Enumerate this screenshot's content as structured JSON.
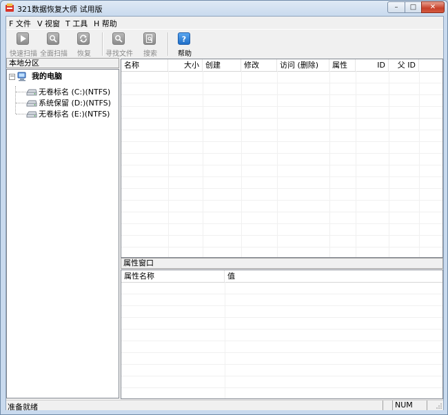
{
  "window": {
    "title": "321数据恢复大师 试用版",
    "controls": {
      "minimize": "–",
      "maximize": "□",
      "close": "✕"
    }
  },
  "menu": [
    {
      "label": "F 文件"
    },
    {
      "label": "V 视窗"
    },
    {
      "label": "T 工具"
    },
    {
      "label": "H 帮助"
    }
  ],
  "toolbar": {
    "buttons": [
      {
        "label": "快速扫描",
        "icon": "play-icon",
        "enabled": false
      },
      {
        "label": "全面扫描",
        "icon": "scan-icon",
        "enabled": false
      },
      {
        "label": "恢复",
        "icon": "recover-icon",
        "enabled": false
      },
      {
        "label": "寻找文件",
        "icon": "find-file-icon",
        "enabled": false
      },
      {
        "label": "搜索",
        "icon": "search-icon",
        "enabled": false
      },
      {
        "label": "帮助",
        "icon": "help-icon",
        "enabled": true
      }
    ]
  },
  "left_pane": {
    "caption": "本地分区",
    "tree": {
      "root": {
        "label": "我的电脑",
        "expander": "−"
      },
      "drives": [
        {
          "label": "无卷标名 (C:)(NTFS)"
        },
        {
          "label": "系统保留 (D:)(NTFS)"
        },
        {
          "label": "无卷标名 (E:)(NTFS)"
        }
      ]
    }
  },
  "file_list": {
    "columns": [
      "名称",
      "大小",
      "创建",
      "修改",
      "访问 (删除)",
      "属性",
      "ID",
      "父 ID"
    ],
    "rows": []
  },
  "properties": {
    "caption": "属性窗口",
    "columns": [
      "属性名称",
      "值"
    ],
    "rows": []
  },
  "status": {
    "text": "准备就绪",
    "num": "NUM"
  },
  "colors": {
    "frame": "#c9daee",
    "help_icon": "#1f6fc8",
    "close_button": "#c7402a"
  }
}
